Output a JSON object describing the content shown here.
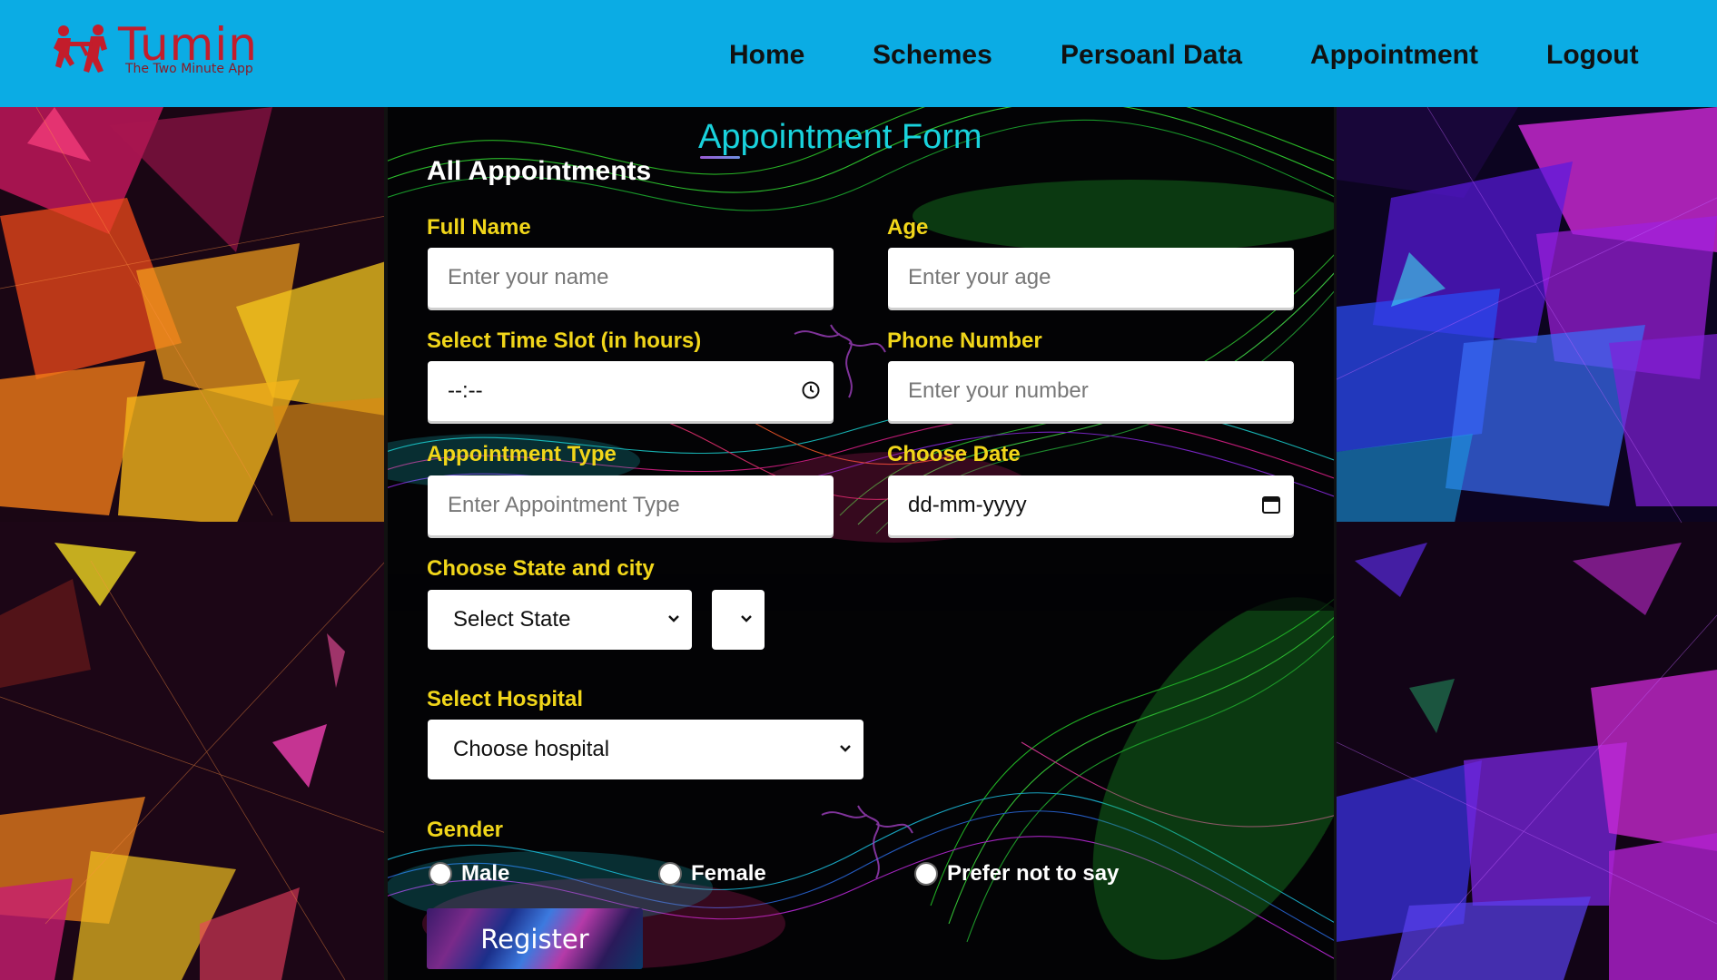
{
  "brand": {
    "name": "Tumin",
    "tagline": "The Two Minute App",
    "color": "#c31d2b"
  },
  "navbar": {
    "bg_color": "#0bace4",
    "links": [
      "Home",
      "Schemes",
      "Persoanl Data",
      "Appointment",
      "Logout"
    ]
  },
  "form": {
    "title": "Appointment Form",
    "subtitle": "All Appointments",
    "full_name": {
      "label": "Full Name",
      "placeholder": "Enter your name"
    },
    "age": {
      "label": "Age",
      "placeholder": "Enter your age"
    },
    "time_slot": {
      "label": "Select Time Slot (in hours)",
      "value": "--:--"
    },
    "phone": {
      "label": "Phone Number",
      "placeholder": "Enter your number"
    },
    "appt_type": {
      "label": "Appointment Type",
      "placeholder": "Enter Appointment Type"
    },
    "date": {
      "label": "Choose Date",
      "value": "dd-mm-yyyy"
    },
    "state_city": {
      "label": "Choose State and city",
      "state_value": "Select State",
      "city_value": ""
    },
    "hospital": {
      "label": "Select Hospital",
      "value": "Choose hospital"
    },
    "gender": {
      "label": "Gender",
      "options": [
        "Male",
        "Female",
        "Prefer not to say"
      ]
    },
    "register_label": "Register",
    "label_color": "#f1d61a",
    "title_color": "#19d2dc"
  }
}
